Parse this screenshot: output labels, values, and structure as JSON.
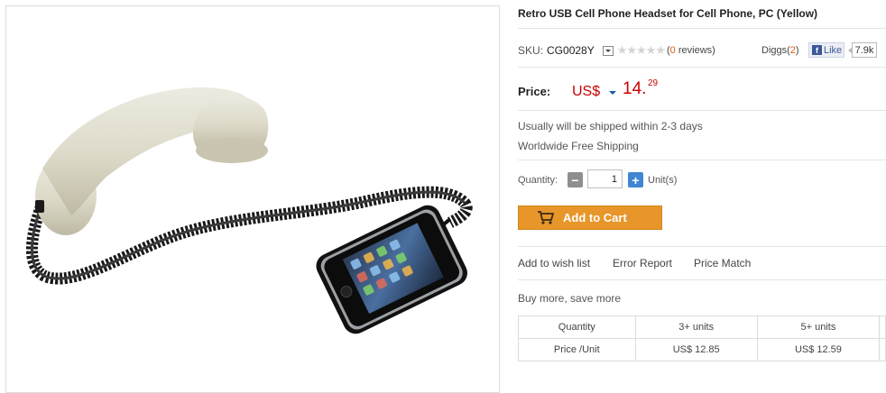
{
  "product": {
    "title": "Retro USB Cell Phone Headset for Cell Phone, PC (Yellow)",
    "image_name": "retro-handset-with-phone"
  },
  "sku": {
    "label": "SKU:",
    "value": "CG0028Y",
    "rating_stars": "★★★★★",
    "rating": 0,
    "reviews_open": "(",
    "reviews_count": "0",
    "reviews_close": " reviews)"
  },
  "social": {
    "diggs_label": "Diggs(",
    "diggs_count": "2",
    "diggs_close": ")",
    "fb_icon": "f",
    "fb_like": "Like",
    "fb_count": "7.9k"
  },
  "price": {
    "label": "Price:",
    "currency": "US$",
    "integer": "14.",
    "decimal": "29"
  },
  "shipping": {
    "line1": "Usually will be shipped within 2-3 days",
    "line2": "Worldwide Free Shipping"
  },
  "quantity": {
    "label": "Quantity:",
    "value": "1",
    "minus": "−",
    "plus": "+",
    "unit": "Unit(s)"
  },
  "cart": {
    "label": "Add to Cart",
    "icon": "cart-icon"
  },
  "links": {
    "wish": "Add to wish list",
    "error": "Error Report",
    "price_match": "Price Match"
  },
  "bulk": {
    "heading": "Buy more, save more",
    "row1": [
      "Quantity",
      "3+ units",
      "5+ units",
      ""
    ],
    "row2": [
      "Price /Unit",
      "US$ 12.85",
      "US$ 12.59",
      ""
    ]
  },
  "colors": {
    "price_red": "#cc0000",
    "cart_orange": "#e8962a",
    "link_orange": "#e05a10",
    "facebook_blue": "#3b5998"
  }
}
